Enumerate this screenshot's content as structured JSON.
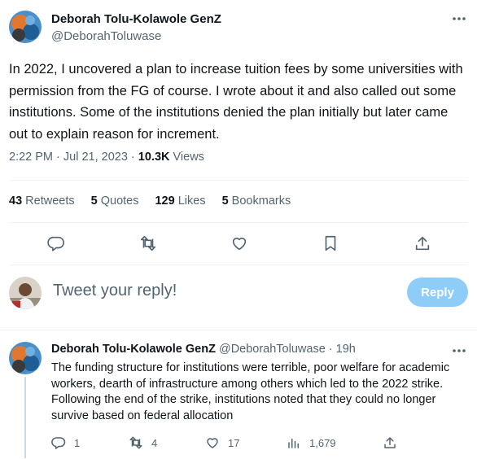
{
  "tweet": {
    "author_name": "Deborah Tolu-Kolawole GenZ",
    "author_handle": "@DeborahToluwase",
    "text": "In 2022, I uncovered a plan to increase tuition fees by some universities with permission from the FG of course. I wrote about it and also called out some institutions. Some of the institutions denied the plan initially but later came out to explain reason for increment.",
    "time": "2:22 PM · Jul 21, 2023 · ",
    "views_count": "10.3K",
    "views_label": " Views",
    "stats": {
      "retweets_count": "43",
      "retweets_label": " Retweets",
      "quotes_count": "5",
      "quotes_label": " Quotes",
      "likes_count": "129",
      "likes_label": " Likes",
      "bookmarks_count": "5",
      "bookmarks_label": " Bookmarks"
    },
    "actions": [
      "reply-icon",
      "retweet-icon",
      "like-icon",
      "bookmark-icon",
      "share-icon"
    ]
  },
  "reply_box": {
    "placeholder": "Tweet your reply!",
    "button_label": "Reply"
  },
  "comment": {
    "author_name": "Deborah Tolu-Kolawole GenZ",
    "author_handle": "@DeborahToluwase",
    "time": " · 19h",
    "text": "The funding structure for institutions were terrible, poor welfare for academic workers, dearth of infrastructure among others which led to the 2022 strike. Following the end of the strike, institutions noted that they could no longer survive based on federal allocation",
    "replies": "1",
    "retweets": "4",
    "likes": "17",
    "views": "1,679"
  },
  "colors": {
    "text_primary": "#0f1419",
    "text_secondary": "#536471",
    "reply_button": "#8ecdf8",
    "divider": "#eff3f4"
  }
}
